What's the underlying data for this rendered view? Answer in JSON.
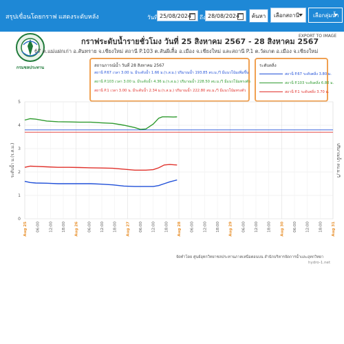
{
  "nav": {
    "summary_link": "สรุปเขื่อนโดยกราฟ",
    "show_all_link": "แสดงระดับหลัง",
    "start_label": "วันที่",
    "start_date": "25/08/2024",
    "end_label": "ถึง",
    "end_date": "28/08/2024",
    "search_button": "ค้นหา",
    "station_select": "เลือกสถานี",
    "group_select": "เลือกลุ่มน้ำ"
  },
  "header": {
    "title": "กราฟระดับน้ำรายชั่วโมง วันที่ 25 สิงหาคม 2567 - 28 สิงหาคม 2567",
    "export": "EXPORT TO IMAGE",
    "subtitle": "67 ต.แม่แฝกเก่า อ.สันทราย จ.เชียงใหม่ สถานี P.103 ต.สันผีเสื้อ อ.เมือง จ.เชียงใหม่ และสถานี P.1 ต.วัดเกต อ.เมือง จ.เชียงใหม่",
    "logo_text": "กรมชลประทาน"
  },
  "status_box": {
    "title": "สถานการณ์น้ำ วันที่ 28 สิงหาคม 2567",
    "lines": [
      {
        "text": "สถานี P.67 เวลา 3.00 น. มีระดับน้ำ 1.66 ม.(ร.ส.ม.) ปริมาณน้ำ 193.85 ลบ.ม./วิ มีแนวโน้มเพิ่มขึ้น",
        "color": "#1f4fd8"
      },
      {
        "text": "สถานี P.103 เวลา 3.00 น. มีระดับน้ำ 4.36 ม.(ร.ส.ม.) ปริมาณน้ำ 228.50 ลบ.ม./วิ มีแนวโน้มทรงตัว",
        "color": "#2e9a2e"
      },
      {
        "text": "สถานี P.1 เวลา 3.00 น. มีระดับน้ำ 2.34 ม.(ร.ส.ม.) ปริมาณน้ำ 222.80 ลบ.ม./วิ มีแนวโน้มทรงตัว",
        "color": "#e0302a"
      }
    ]
  },
  "legend_box": {
    "title": "ระดับตลิ่ง",
    "items": [
      {
        "text": "สถานี P.67 ระดับตลิ่ง 3.80 ม.",
        "color": "#1f4fd8"
      },
      {
        "text": "สถานี P.103 ระดับตลิ่ง 6.80 ม.",
        "color": "#2e9a2e"
      },
      {
        "text": "สถานี P.1 ระดับตลิ่ง 3.70 ม.",
        "color": "#e0302a"
      }
    ]
  },
  "credit": {
    "line1": "จัดทำโดย ศูนย์อุทกวิทยาชลประทานภาคเหนือตอนบน สำนักบริหารจัดการน้ำและอุทกวิทยา",
    "line2": "hydro-1.net"
  },
  "chart_data": {
    "type": "line",
    "ylabel": "ระดับน้ำ ม.(ร.ส.ม.)",
    "y2label": "ปริมาณน้ำ ลบ.ม./วิ",
    "ylim": [
      0,
      5
    ],
    "yticks": [
      "0",
      "1",
      "2",
      "3",
      "4",
      "5"
    ],
    "x_range_hours": [
      0,
      168
    ],
    "xticks": [
      {
        "label": "Aug 25",
        "day": true
      },
      {
        "label": "06:00"
      },
      {
        "label": "12:00"
      },
      {
        "label": "18:00"
      },
      {
        "label": "Aug 26",
        "day": true
      },
      {
        "label": "06:00"
      },
      {
        "label": "12:00"
      },
      {
        "label": "18:00"
      },
      {
        "label": "Aug 27",
        "day": true
      },
      {
        "label": "06:00"
      },
      {
        "label": "12:00"
      },
      {
        "label": "18:00"
      },
      {
        "label": "Aug 28",
        "day": true
      },
      {
        "label": "06:00"
      },
      {
        "label": "12:00"
      },
      {
        "label": "18:00"
      },
      {
        "label": "Aug 29",
        "day": true
      },
      {
        "label": "06:00"
      },
      {
        "label": "12:00"
      },
      {
        "label": "18:00"
      },
      {
        "label": "Aug 30",
        "day": true
      },
      {
        "label": "06:00"
      },
      {
        "label": "12:00"
      },
      {
        "label": "18:00"
      },
      {
        "label": "Aug 31",
        "day": true
      }
    ],
    "grid": true,
    "series": [
      {
        "name": "P.103",
        "color": "#2e9a2e",
        "x": [
          0,
          3,
          6,
          12,
          18,
          24,
          30,
          36,
          42,
          48,
          54,
          60,
          63,
          66,
          70,
          73,
          75,
          78,
          81,
          83
        ],
        "y": [
          4.22,
          4.28,
          4.26,
          4.18,
          4.15,
          4.14,
          4.13,
          4.13,
          4.1,
          4.08,
          4.0,
          3.9,
          3.82,
          3.84,
          4.05,
          4.3,
          4.36,
          4.36,
          4.35,
          4.36
        ]
      },
      {
        "name": "P.1",
        "color": "#e0302a",
        "x": [
          0,
          3,
          6,
          12,
          18,
          24,
          30,
          36,
          42,
          48,
          54,
          60,
          66,
          70,
          73,
          76,
          79,
          83
        ],
        "y": [
          2.2,
          2.25,
          2.24,
          2.22,
          2.2,
          2.2,
          2.19,
          2.18,
          2.17,
          2.16,
          2.12,
          2.08,
          2.08,
          2.1,
          2.18,
          2.3,
          2.32,
          2.3
        ]
      },
      {
        "name": "P.67",
        "color": "#1f4fd8",
        "x": [
          0,
          3,
          6,
          12,
          18,
          24,
          30,
          36,
          42,
          48,
          54,
          60,
          66,
          70,
          73,
          76,
          79,
          83
        ],
        "y": [
          1.6,
          1.55,
          1.53,
          1.52,
          1.5,
          1.5,
          1.5,
          1.5,
          1.48,
          1.45,
          1.4,
          1.38,
          1.38,
          1.38,
          1.42,
          1.5,
          1.58,
          1.66
        ]
      }
    ],
    "bank_levels": [
      {
        "name": "P.67",
        "value": 3.8,
        "color": "#1f4fd8"
      },
      {
        "name": "P.1",
        "value": 3.7,
        "color": "#e0302a"
      }
    ]
  }
}
